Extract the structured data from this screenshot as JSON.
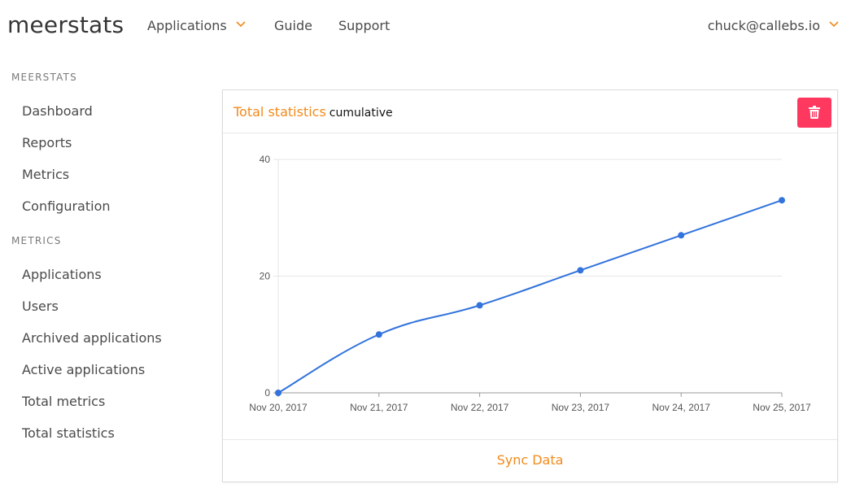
{
  "brand": "meerstats",
  "nav": {
    "applications_label": "Applications",
    "guide_label": "Guide",
    "support_label": "Support",
    "user_email": "chuck@callebs.io",
    "dropdown_icon": "chevron-down-icon",
    "accent_color": "#f28a1a"
  },
  "sidebar": {
    "sections": [
      {
        "label": "MEERSTATS",
        "items": [
          "Dashboard",
          "Reports",
          "Metrics",
          "Configuration"
        ]
      },
      {
        "label": "METRICS",
        "items": [
          "Applications",
          "Users",
          "Archived applications",
          "Active applications",
          "Total metrics",
          "Total statistics"
        ]
      }
    ]
  },
  "card": {
    "title": "Total statistics",
    "subtitle": "cumulative",
    "delete_icon": "trash-icon",
    "delete_color": "#ff3860",
    "footer_link": "Sync Data"
  },
  "chart_data": {
    "type": "line",
    "categories": [
      "Nov 20, 2017",
      "Nov 21, 2017",
      "Nov 22, 2017",
      "Nov 23, 2017",
      "Nov 24, 2017",
      "Nov 25, 2017"
    ],
    "series": [
      {
        "values": [
          0,
          10,
          15,
          21,
          27,
          33
        ],
        "color": "#3273dc"
      }
    ],
    "yticks": [
      0,
      20,
      40
    ],
    "ylim": [
      0,
      40
    ],
    "grid": true,
    "title": "",
    "xlabel": "",
    "ylabel": ""
  }
}
